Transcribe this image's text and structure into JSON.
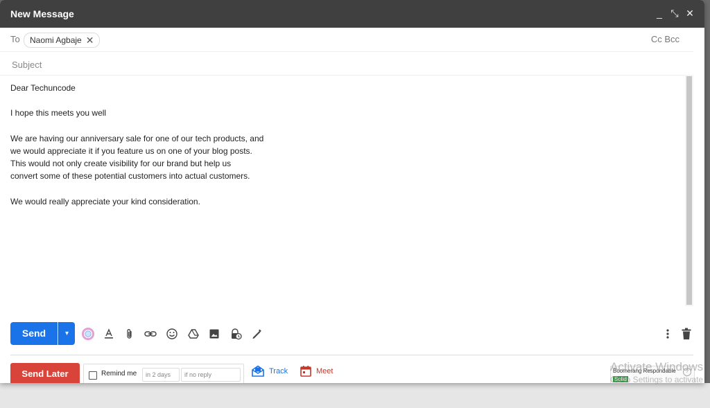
{
  "window": {
    "title": "New Message",
    "controls": {
      "minimize": "_",
      "expand": "⤡",
      "close": "✕"
    }
  },
  "recipients": {
    "label": "To",
    "chips": [
      {
        "name": "Naomi Agbaje",
        "remove_icon": "✕"
      }
    ],
    "cc_bcc": "Cc Bcc"
  },
  "subject": {
    "placeholder": "Subject",
    "value": ""
  },
  "body": {
    "text": "Dear Techuncode\n\nI hope this meets you well\n\nWe are having our anniversary sale for one of our tech products, and\nwe would appreciate it if you feature us on one of your blog posts.\nThis would not only create visibility for our brand but help us\nconvert some of these potential customers into actual customers.\n\nWe would really appreciate your kind consideration."
  },
  "toolbar": {
    "send_label": "Send",
    "send_options_icon": "▾",
    "icons": [
      "color-palette-icon",
      "format-text-icon",
      "attach-icon",
      "link-icon",
      "emoji-icon",
      "drive-icon",
      "image-icon",
      "lock-clock-icon",
      "signature-icon",
      "more-options-icon",
      "trash-icon"
    ]
  },
  "bottom": {
    "send_later_label": "Send Later",
    "remind_label": "Remind me",
    "remind_days_placeholder": "in 2 days",
    "remind_condition_placeholder": "if no reply",
    "track_label": "Track",
    "meet_label": "Meet",
    "boomerang_title": "Boomerang Respondable",
    "boomerang_status": "Solid",
    "boomerang_help": "?"
  },
  "watermark": {
    "line1": "Activate Windows",
    "line2": "Go to Settings to activate"
  },
  "colors": {
    "titlebar": "#404040",
    "send": "#1a73e8",
    "send_later": "#d9443a",
    "track": "#1a73e8",
    "meet": "#c0392b",
    "boomerang_status": "#2e9a3a"
  }
}
